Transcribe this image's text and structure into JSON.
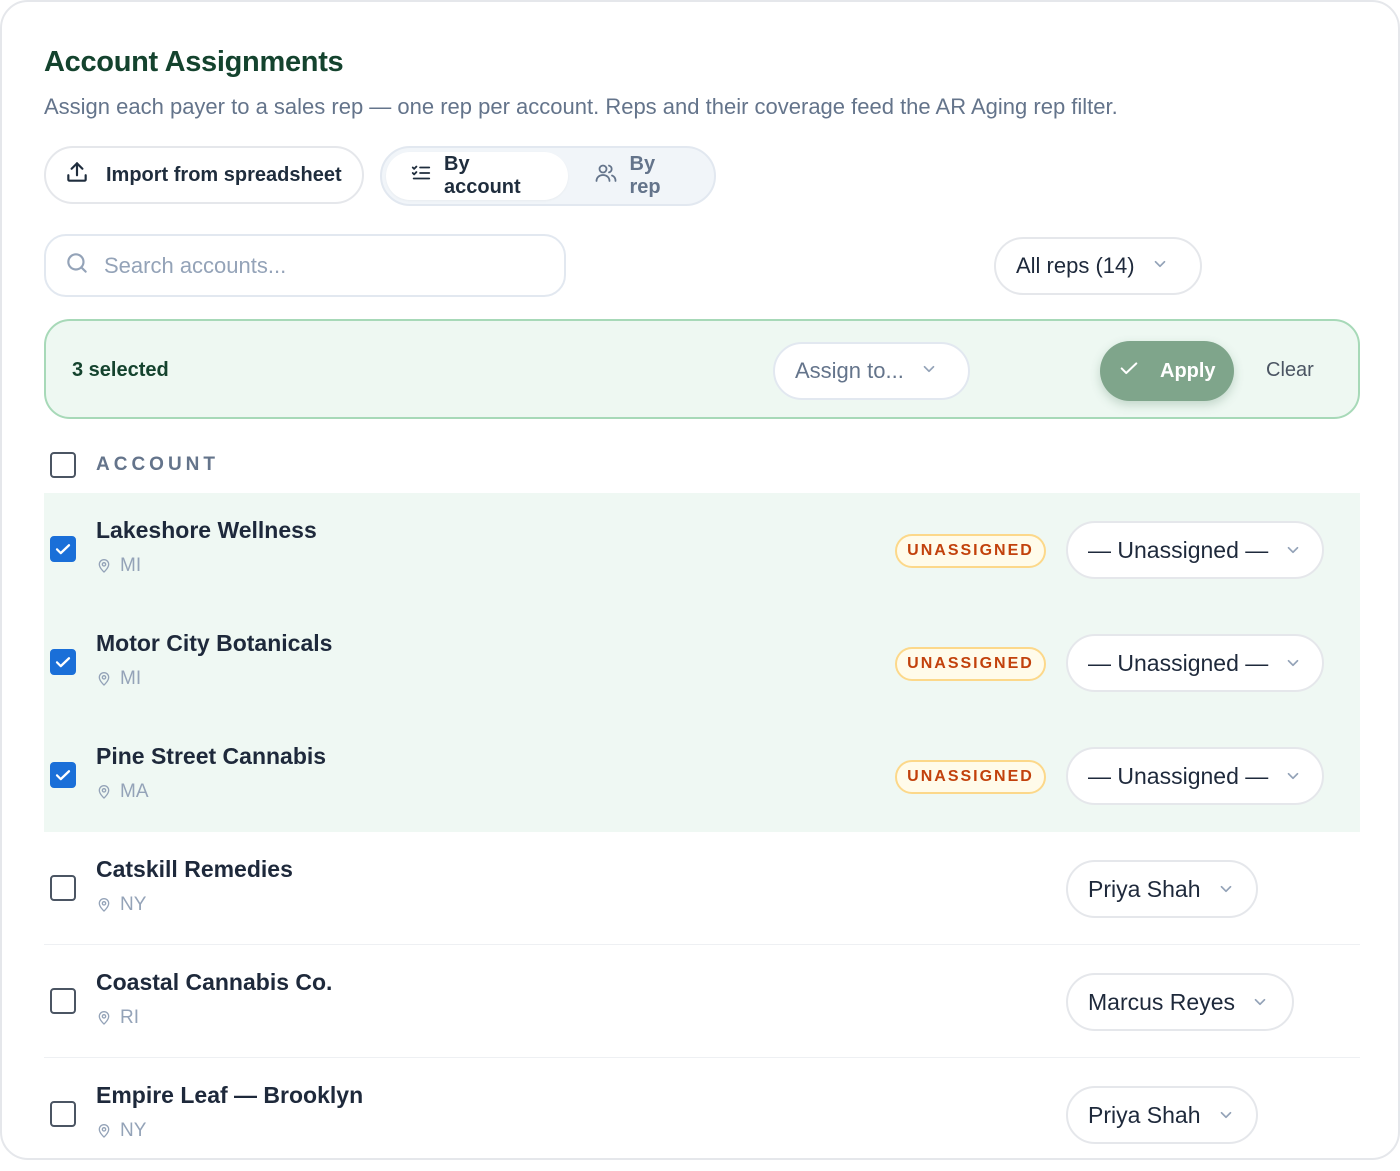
{
  "header": {
    "title": "Account Assignments",
    "subtitle": "Assign each payer to a sales rep — one rep per account. Reps and their coverage feed the AR Aging rep filter."
  },
  "toolbar": {
    "import_label": "Import from spreadsheet",
    "view_toggle": [
      {
        "label": "By account",
        "active": true,
        "icon": "list-check-icon"
      },
      {
        "label": "By rep",
        "active": false,
        "icon": "users-icon"
      }
    ]
  },
  "filters": {
    "search_placeholder": "Search accounts...",
    "search_value": "",
    "rep_filter_value": "All reps (14)"
  },
  "selection_bar": {
    "count_label": "3 selected",
    "assign_placeholder": "Assign to...",
    "apply_label": "Apply",
    "clear_label": "Clear"
  },
  "table": {
    "column_header": "ACCOUNT",
    "badge_label": "UNASSIGNED",
    "rows": [
      {
        "name": "Lakeshore Wellness",
        "state": "MI",
        "checked": true,
        "rep": "— Unassigned —",
        "unassigned": true
      },
      {
        "name": "Motor City Botanicals",
        "state": "MI",
        "checked": true,
        "rep": "— Unassigned —",
        "unassigned": true
      },
      {
        "name": "Pine Street Cannabis",
        "state": "MA",
        "checked": true,
        "rep": "— Unassigned —",
        "unassigned": true
      },
      {
        "name": "Catskill Remedies",
        "state": "NY",
        "checked": false,
        "rep": "Priya Shah",
        "unassigned": false
      },
      {
        "name": "Coastal Cannabis Co.",
        "state": "RI",
        "checked": false,
        "rep": "Marcus Reyes",
        "unassigned": false
      },
      {
        "name": "Empire Leaf — Brooklyn",
        "state": "NY",
        "checked": false,
        "rep": "Priya Shah",
        "unassigned": false
      }
    ]
  },
  "colors": {
    "brand_green": "#14432e",
    "apply_green": "#7fa58b",
    "checkbox_blue": "#1a6fd8",
    "badge_orange": "#c2410c"
  }
}
